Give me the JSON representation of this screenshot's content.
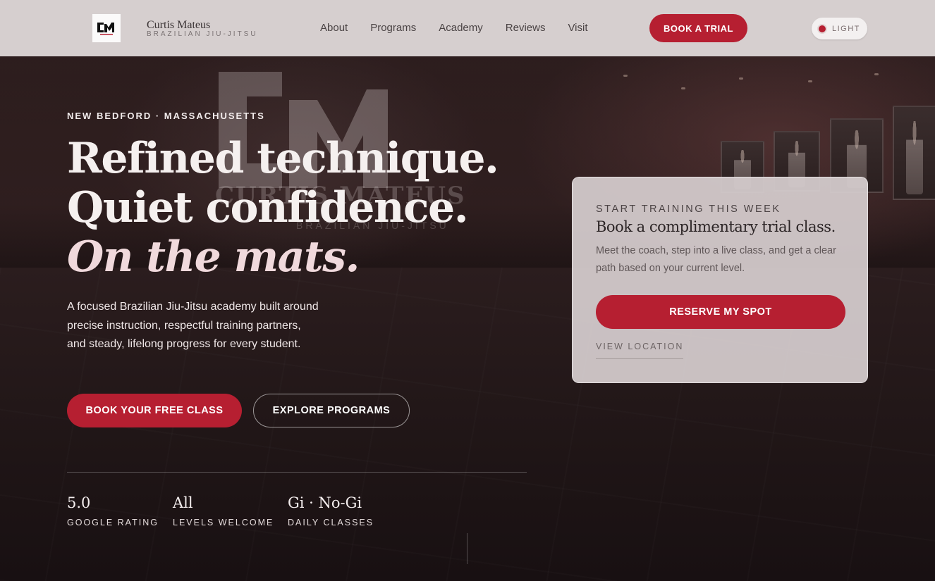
{
  "brand": {
    "name": "Curtis Mateus",
    "subtitle": "BRAZILIAN JIU-JITSU",
    "mark": "CM"
  },
  "nav": {
    "links": [
      "About",
      "Programs",
      "Academy",
      "Reviews",
      "Visit"
    ],
    "cta_label": "BOOK A TRIAL",
    "theme_toggle_label": "LIGHT"
  },
  "hero": {
    "eyebrow": "NEW BEDFORD · MASSACHUSETTS",
    "headline_line1": "Refined technique.",
    "headline_line2": "Quiet confidence.",
    "headline_line3": "On the mats.",
    "lede": "A focused Brazilian Jiu-Jitsu academy built around precise instruction, respectful training partners, and steady, lifelong progress for every student.",
    "primary_cta": "BOOK YOUR FREE CLASS",
    "secondary_cta": "EXPLORE PROGRAMS"
  },
  "stats": [
    {
      "value": "5.0",
      "label": "GOOGLE RATING"
    },
    {
      "value": "All",
      "label": "LEVELS WELCOME"
    },
    {
      "value": "Gi · No-Gi",
      "label": "DAILY CLASSES"
    }
  ],
  "trial_card": {
    "eyebrow": "START TRAINING THIS WEEK",
    "title": "Book a complimentary trial class.",
    "text": "Meet the coach, step into a live class, and get a clear path based on your current level.",
    "button": "RESERVE MY SPOT",
    "link": "VIEW LOCATION"
  },
  "background_sign": {
    "title": "CURTIS MATEUS",
    "subtitle": "BRAZILIAN JIU-JITSU"
  },
  "colors": {
    "accent": "#b61f31",
    "nav_bg": "#d6cfcf",
    "hero_bg": "#1d1213",
    "card_bg": "#d6cecf"
  },
  "icons": {
    "brand_mark": "cm-logo-icon",
    "theme_toggle": "theme-dot-icon"
  }
}
